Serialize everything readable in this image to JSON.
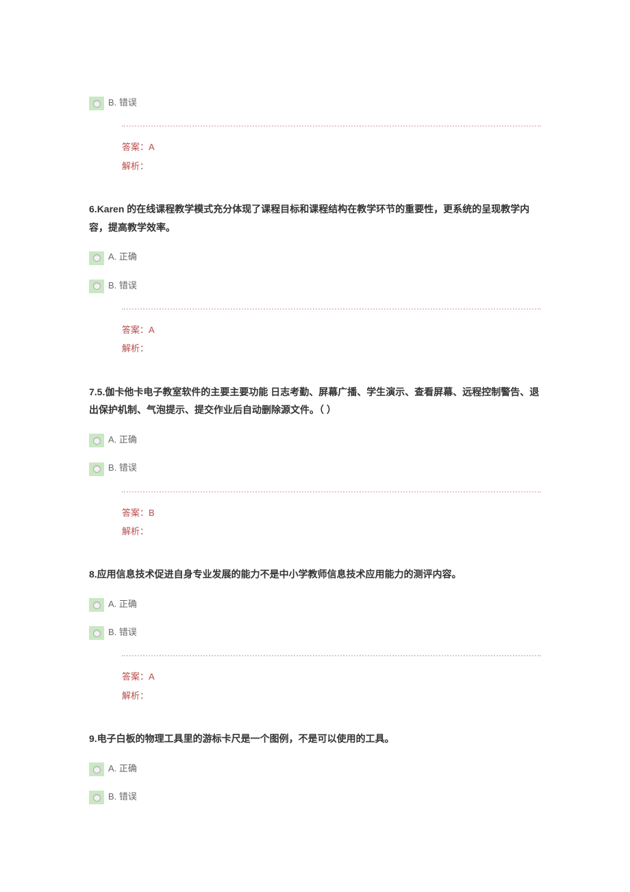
{
  "options_generic": {
    "A_label": "A. 正确",
    "B_label": "B. 错误"
  },
  "answer_labels": {
    "answer": "答案：",
    "analysis": "解析："
  },
  "q5_tail": {
    "optionB": "B. 错误",
    "answer": "A"
  },
  "q6": {
    "num": "6.",
    "strong_part": "Karen",
    "body": " 的在线课程教学模式充分体现了课程目标和课程结构在教学环节的重要性，更系统的呈现教学内容，提高教学效率。",
    "optionA": "A. 正确",
    "optionB": "B. 错误",
    "answer": "A"
  },
  "q7": {
    "num": "7.5.",
    "body": "伽卡他卡电子教室软件的主要主要功能 日志考勤、屏幕广播、学生演示、查看屏幕、远程控制警告、退出保护机制、气泡提示、提交作业后自动删除源文件。（ ）",
    "optionA": "A. 正确",
    "optionB": "B. 错误",
    "answer": "B"
  },
  "q8": {
    "num": "8.",
    "body": "应用信息技术促进自身专业发展的能力不是中小学教师信息技术应用能力的测评内容。",
    "optionA": "A. 正确",
    "optionB": "B. 错误",
    "answer": "A"
  },
  "q9": {
    "num": "9.",
    "body": "电子白板的物理工具里的游标卡尺是一个图例，不是可以使用的工具。",
    "optionA": "A. 正确",
    "optionB": "B. 错误"
  }
}
